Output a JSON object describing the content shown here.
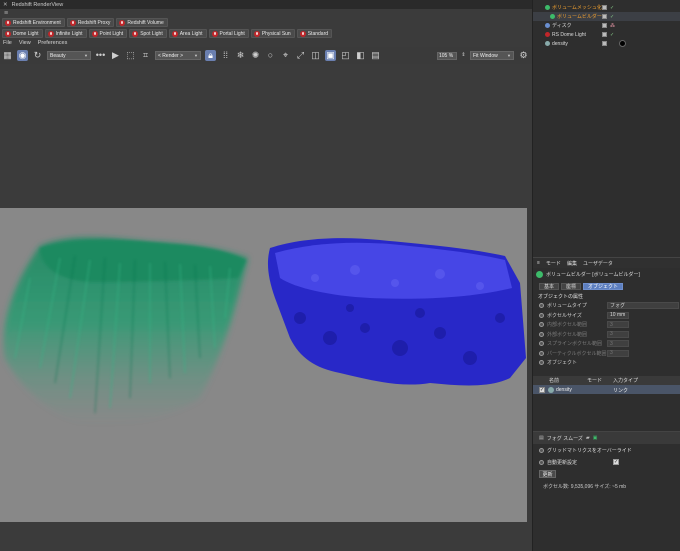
{
  "window": {
    "title": "Redshift RenderView"
  },
  "chips_row1": [
    "Redshift Environment",
    "Redshift Proxy",
    "Redshift Volume"
  ],
  "chips_row2": [
    "Dome Light",
    "Infinite Light",
    "Point Light",
    "Spot Light",
    "Area Light",
    "Portal Light",
    "Physical Sun",
    "Standard"
  ],
  "rv_menu": [
    "File",
    "View",
    "Preferences"
  ],
  "toolbar": {
    "aov_select": "Beauty",
    "camera_select": "< Render >",
    "zoom_value": "105 %",
    "fit_select": "Fit Window"
  },
  "object_manager": {
    "items": [
      {
        "label": "ボリュームメッシュ化"
      },
      {
        "label": "ボリュームビルダー"
      },
      {
        "label": "ディスク"
      },
      {
        "label": "RS Dome Light"
      },
      {
        "label": "density"
      }
    ]
  },
  "attributes": {
    "header_tabs": [
      "モード",
      "編集",
      "ユーザデータ"
    ],
    "object_title": "ボリュームビルダー [ボリュームビルダー]",
    "tabs": [
      "基本",
      "座標",
      "オブジェクト"
    ],
    "section_title": "オブジェクトの属性",
    "rows": [
      {
        "name": "ボリュームタイプ",
        "value": "フォグ"
      },
      {
        "name": "ボクセルサイズ",
        "value": "10 mm"
      },
      {
        "name": "内部ボクセル範囲",
        "value": "3"
      },
      {
        "name": "外部ボクセル範囲",
        "value": "3"
      },
      {
        "name": "スプラインボクセル範囲",
        "value": "3"
      },
      {
        "name": "パーティクルボクセル範囲",
        "value": "3"
      },
      {
        "name": "オブジェクト",
        "value": ""
      }
    ],
    "columns": [
      "名前",
      "モード",
      "入力タイプ"
    ],
    "texture_row": {
      "name": "density",
      "type": "リンク"
    },
    "lower_header": "フォグ スムーズ",
    "grid_override": "グリッドマトリクスをオーバーライド",
    "auto_update": "自動更新設定",
    "update_button": "更新",
    "info": "ボクセル数: 9,535,096 サイズ: ~5 mb"
  }
}
